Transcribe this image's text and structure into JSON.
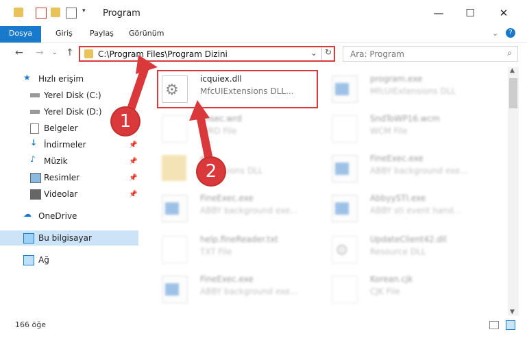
{
  "window": {
    "title": "Program",
    "minimize": "—",
    "maximize": "☐",
    "close": "✕"
  },
  "ribbon": {
    "tabs": [
      "Dosya",
      "Giriş",
      "Paylaş",
      "Görünüm"
    ]
  },
  "address": {
    "path": "C:\\Program Files\\Program Dizini",
    "search_placeholder": "Ara: Program"
  },
  "sidebar": {
    "items": [
      {
        "label": "Hızlı erişim",
        "icon": "star-icon"
      },
      {
        "label": "Yerel Disk (C:)",
        "icon": "drive-icon"
      },
      {
        "label": "Yerel Disk (D:)",
        "icon": "drive-icon"
      },
      {
        "label": "Belgeler",
        "icon": "documents-icon"
      },
      {
        "label": "İndirmeler",
        "icon": "download-icon"
      },
      {
        "label": "Müzik",
        "icon": "music-icon"
      },
      {
        "label": "Resimler",
        "icon": "pictures-icon"
      },
      {
        "label": "Videolar",
        "icon": "videos-icon"
      },
      {
        "label": "OneDrive",
        "icon": "cloud-icon"
      },
      {
        "label": "Bu bilgisayar",
        "icon": "computer-icon"
      },
      {
        "label": "Ağ",
        "icon": "network-icon"
      }
    ]
  },
  "files": [
    {
      "name": "icquiex.dll",
      "type": "MfcUIExtensions DLL...",
      "icon": "gear-dll-icon",
      "highlight": true
    },
    {
      "name": "program.exe",
      "type": "MfcUIExtensions DLL",
      "icon": "app-icon"
    },
    {
      "name": "Fhsec.wrd",
      "type": "WRD File",
      "icon": "document-icon"
    },
    {
      "name": "SndToWP16.wcm",
      "type": "WCM File",
      "icon": "document-icon"
    },
    {
      "name": "eld",
      "type": "Extensions DLL",
      "icon": "folder-icon"
    },
    {
      "name": "FineExec.exe",
      "type": "ABBY background exe...",
      "icon": "app-icon"
    },
    {
      "name": "FineExec.exe",
      "type": "ABBY background exe...",
      "icon": "app-icon"
    },
    {
      "name": "AbbyySTI.exe",
      "type": "ABBY sti event hand...",
      "icon": "app-icon"
    },
    {
      "name": "help.fineReader.txt",
      "type": "TXT File",
      "icon": "document-icon"
    },
    {
      "name": "UpdateClient42.dll",
      "type": "Resource DLL",
      "icon": "gear-dll-icon"
    },
    {
      "name": "FineExec.exe",
      "type": "ABBY background exe...",
      "icon": "app-icon"
    },
    {
      "name": "Korean.cjk",
      "type": "CJK File",
      "icon": "document-icon"
    }
  ],
  "status": {
    "count": "166 öğe"
  },
  "annotations": {
    "step1": "1",
    "step2": "2"
  },
  "colors": {
    "accent": "#1979ca",
    "annotation": "#d9393a"
  }
}
